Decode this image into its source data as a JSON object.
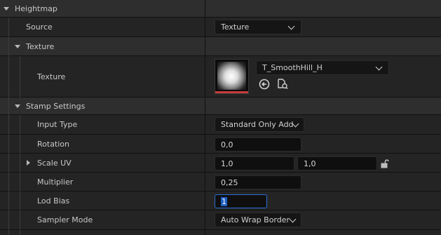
{
  "sections": {
    "heightmap": "Heightmap",
    "texture": "Texture",
    "stamp_settings": "Stamp Settings"
  },
  "source": {
    "label": "Source",
    "value": "Texture"
  },
  "texture": {
    "label": "Texture",
    "asset_name": "T_SmoothHill_H"
  },
  "input_type": {
    "label": "Input Type",
    "value": "Standard Only Add"
  },
  "rotation": {
    "label": "Rotation",
    "value": "0,0"
  },
  "scale_uv": {
    "label": "Scale UV",
    "x": "1,0",
    "y": "1,0"
  },
  "multiplier": {
    "label": "Multiplier",
    "value": "0,25"
  },
  "lod_bias": {
    "label": "Lod Bias",
    "value": "1"
  },
  "sampler_mode": {
    "label": "Sampler Mode",
    "value": "Auto Wrap Border"
  },
  "colors": {
    "selection": "#1f5fc4",
    "focus_border": "#2a6fd6",
    "thumbnail_bar": "#c63b3b"
  },
  "icons": [
    "expand-arrow-icon",
    "collapse-arrow-icon",
    "chevron-down-icon",
    "use-selected-asset-icon",
    "browse-to-asset-icon",
    "lock-icon"
  ]
}
